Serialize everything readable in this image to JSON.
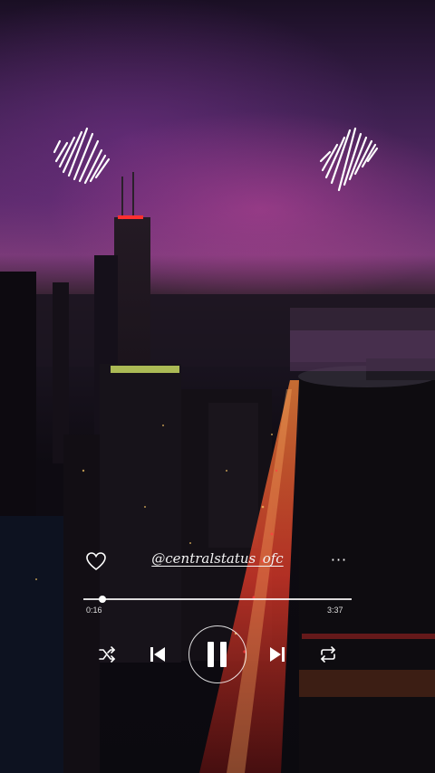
{
  "player": {
    "username": "@centralstatus_ofc",
    "more_label": "···",
    "current_time": "0:16",
    "duration": "3:37",
    "progress": 0.07,
    "is_playing": true
  },
  "icons": {
    "heart": "heart-outline-icon",
    "shuffle": "shuffle-icon",
    "previous": "skip-previous-icon",
    "pause": "pause-icon",
    "next": "skip-next-icon",
    "repeat": "repeat-icon",
    "waveform": "audio-waveform-icon"
  },
  "colors": {
    "sky_purple": "#5a2a6a",
    "sky_pink": "#b04a8a",
    "city_lights": "#ff3a3a",
    "foreground": "#ffffff"
  }
}
